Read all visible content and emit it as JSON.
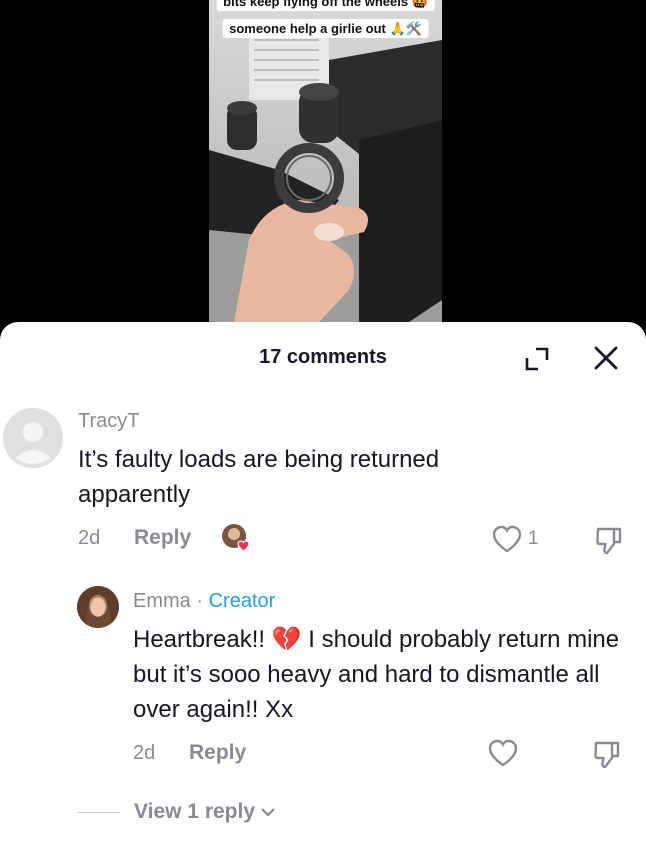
{
  "video": {
    "caption_line1": "bits keep flying off the wheels 🤬",
    "caption_line2": "someone help a girlie out 🙏🛠️"
  },
  "comments_panel": {
    "count_label": "17 comments",
    "comments": [
      {
        "username": "TracyT",
        "text": "It’s faulty loads are being returned apparently",
        "time": "2d",
        "reply_label": "Reply",
        "like_count": "1"
      }
    ],
    "replies": [
      {
        "username": "Emma",
        "separator": "·",
        "badge": "Creator",
        "text": "Heartbreak!! 💔 I should probably return mine but it’s sooo heavy and hard to dismantle all over again!! Xx",
        "time": "2d",
        "reply_label": "Reply"
      }
    ],
    "view_replies_label": "View 1 reply"
  },
  "colors": {
    "creator_badge": "#1fa5c9",
    "heart_badge": "#fe2c55",
    "muted_text": "#8a8b91",
    "primary_text": "#161823"
  },
  "icons": [
    "expand-icon",
    "close-icon",
    "heart-outline-icon",
    "dislike-icon",
    "chevron-down-icon",
    "default-avatar-icon"
  ]
}
